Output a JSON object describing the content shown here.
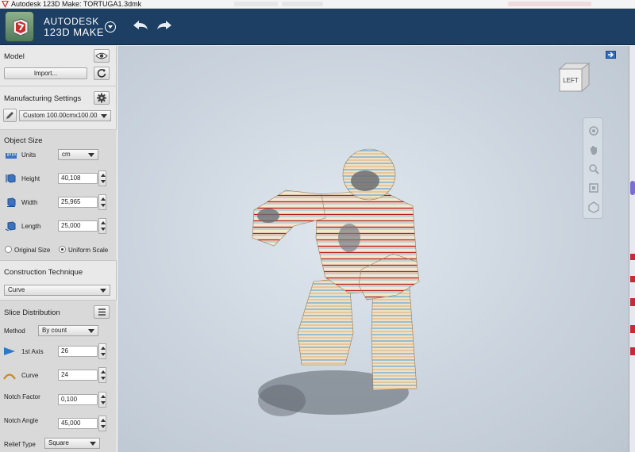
{
  "window": {
    "title": "Autodesk 123D Make: TORTUGA1.3dmk"
  },
  "header": {
    "brand_line1": "AUTODESK",
    "brand_line2": "123D MAKE"
  },
  "model": {
    "title": "Model",
    "import_label": "Import..."
  },
  "manufacturing": {
    "title": "Manufacturing Settings",
    "preset_value": "Custom 100.00cmx100.00"
  },
  "object_size": {
    "title": "Object Size",
    "units_label": "Units",
    "units_value": "cm",
    "height_label": "Height",
    "height_value": "40,108",
    "width_label": "Width",
    "width_value": "25,965",
    "length_label": "Length",
    "length_value": "25,000",
    "original_size_label": "Original Size",
    "uniform_scale_label": "Uniform Scale",
    "uniform_scale_selected": true
  },
  "construction": {
    "title": "Construction Technique",
    "value": "Curve"
  },
  "slice": {
    "title": "Slice Distribution",
    "method_label": "Method",
    "method_value": "By count",
    "axis1_label": "1st Axis",
    "axis1_value": "26",
    "curve_label": "Curve",
    "curve_value": "24",
    "notch_factor_label": "Notch Factor",
    "notch_factor_value": "0,100",
    "notch_angle_label": "Notch Angle",
    "notch_angle_value": "45,000",
    "relief_label": "Relief Type",
    "relief_value": "Square"
  },
  "viewport": {
    "navcube_face": "LEFT"
  },
  "colors": {
    "header": "#1d3f63",
    "panel": "#e9e9e9",
    "slice_red": "#b52020",
    "slice_cream": "#f3e7cf",
    "slice_blue": "#5ea8d8"
  }
}
